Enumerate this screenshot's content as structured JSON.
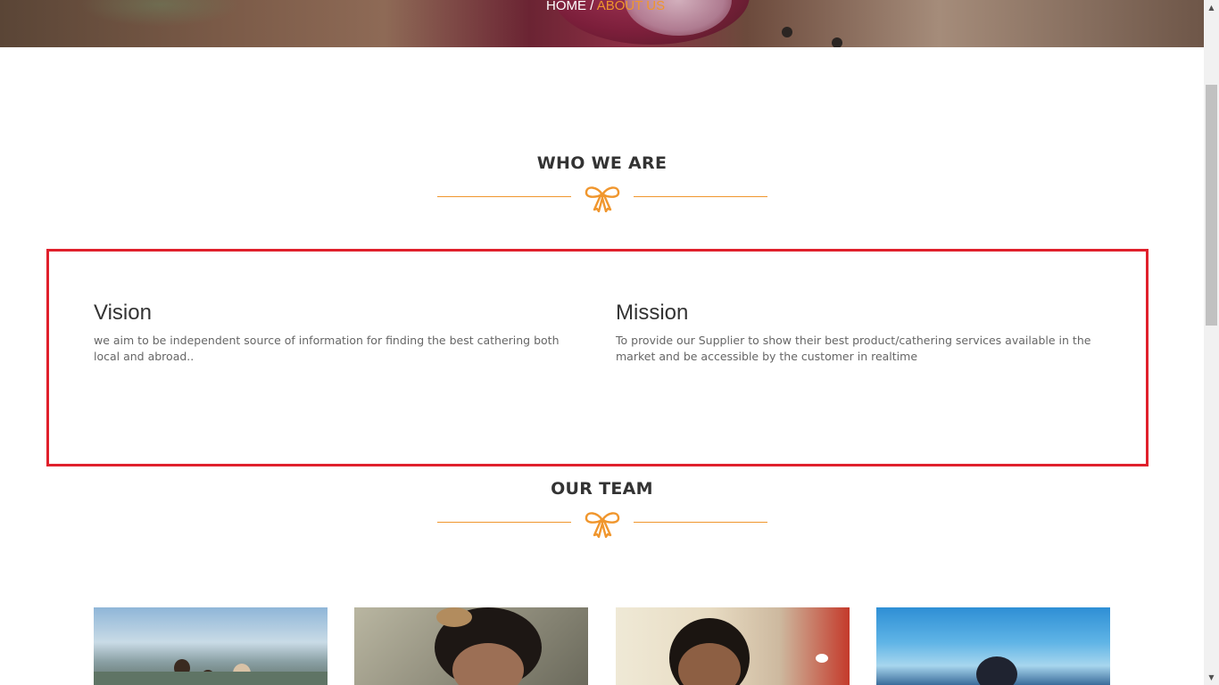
{
  "breadcrumb": {
    "home": "HOME",
    "separator": " / ",
    "current": "ABOUT US"
  },
  "about": {
    "title": "WHO WE ARE",
    "vision": {
      "heading": "Vision",
      "text": "we aim to be independent source of information for finding the best cathering both local and abroad.."
    },
    "mission": {
      "heading": "Mission",
      "text": "To provide our Supplier to show their best product/cathering services available in the market and be accessible by the customer in realtime"
    }
  },
  "team": {
    "title": "OUR TEAM",
    "members": [
      {
        "photo": "team-photo-1"
      },
      {
        "photo": "team-photo-2"
      },
      {
        "photo": "team-photo-3"
      },
      {
        "photo": "team-photo-4"
      }
    ]
  },
  "colors": {
    "accent": "#f0962d",
    "highlight_border": "#e0202c",
    "heading": "#333333"
  },
  "icons": {
    "divider": "bow-ribbon-icon"
  }
}
